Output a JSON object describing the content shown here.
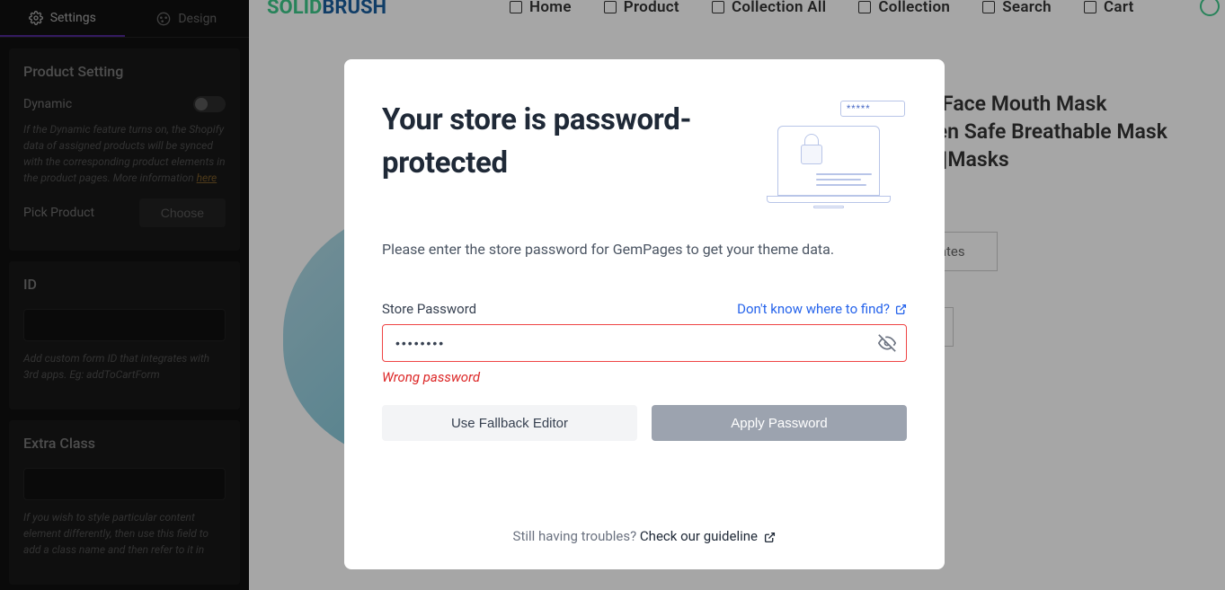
{
  "sidebar": {
    "tabs": {
      "settings": "Settings",
      "design": "Design"
    },
    "product_setting": {
      "title": "Product Setting",
      "dynamic_label": "Dynamic",
      "dynamic_help": "If the Dynamic feature turns on, the Shopify data of assigned products will be synced with the corresponding product elements in the product pages. More information ",
      "here_link": "here",
      "pick_product_label": "Pick Product",
      "choose_btn": "Choose"
    },
    "id_panel": {
      "title": "ID",
      "help": "Add custom form ID that integrates with 3rd apps. Eg: addToCartForm"
    },
    "extra_class": {
      "title": "Extra Class",
      "help": "If you wish to style particular content element differently, then use this field to add a class name and then refer to it in"
    }
  },
  "canvas": {
    "logo": {
      "solid": "SOLID",
      "brush": "BRUSH"
    },
    "nav": [
      "Home",
      "Product",
      "Collection All",
      "Collection",
      "Search",
      "Cart"
    ],
    "product_title": "er Filter Face Mouth Mask\nlon woven Safe Breathable Mask\nBacteria|Masks",
    "ships": "States"
  },
  "modal": {
    "title": "Your store is password-protected",
    "desc": "Please enter the store password for GemPages to get your theme data.",
    "field_label": "Store Password",
    "find_link": "Don't know where to find?",
    "password_value": "********",
    "illustration_dots": "*****",
    "error": "Wrong password",
    "fallback_btn": "Use Fallback Editor",
    "apply_btn": "Apply Password",
    "footer_text": "Still having troubles? ",
    "guideline_link": "Check our guideline"
  }
}
